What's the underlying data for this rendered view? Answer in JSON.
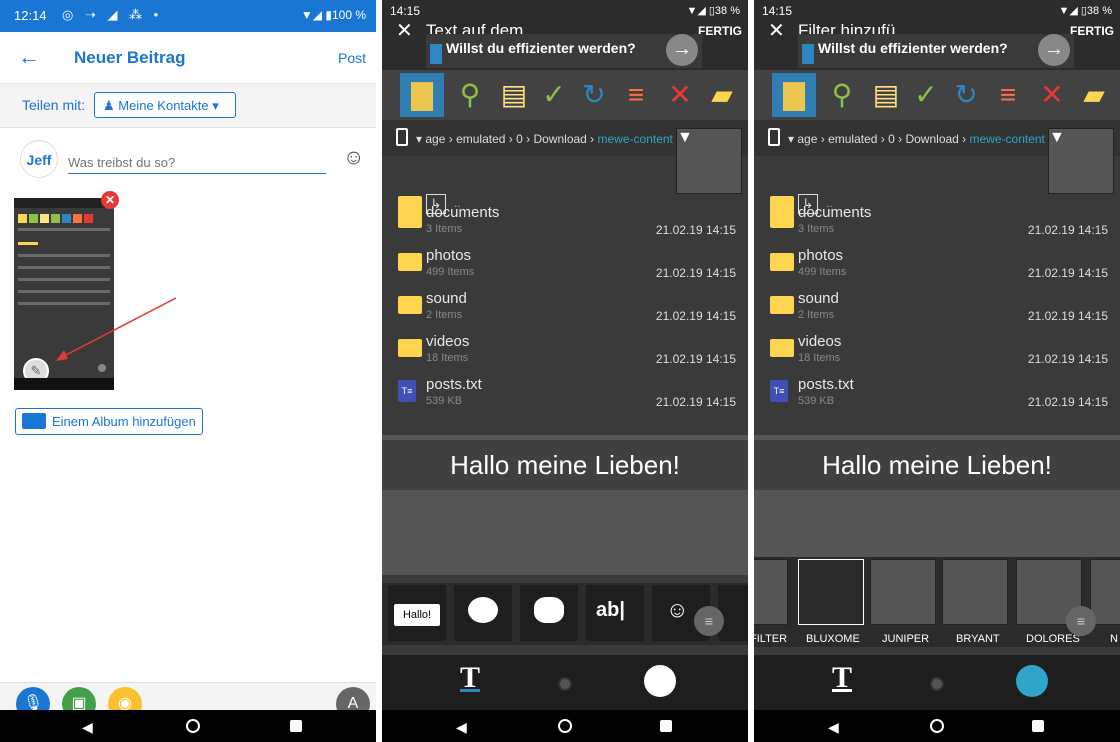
{
  "colors": {
    "blue": "#1976d2",
    "accent": "#2ea5c9",
    "folder": "#ffd54f",
    "panel": "#3a3a3a"
  },
  "p1": {
    "status": {
      "time": "12:14",
      "right": "▼◢ ▮100 %"
    },
    "header": {
      "back_icon": "arrow-left-icon",
      "title": "Neuer Beitrag",
      "post": "Post"
    },
    "share": {
      "label": "Teilen mit:",
      "button": "Meine Kontakte"
    },
    "compose": {
      "avatar": "Jeff",
      "placeholder": "Was treibst du so?"
    },
    "album": "Einem Album hinzufügen"
  },
  "p2": {
    "status": {
      "time": "14:15",
      "right": "▼◢ ▯38 %"
    },
    "title": "Text auf dem...",
    "done": "FERTIG",
    "ad": "Willst du effizienter werden?",
    "path": {
      "crumbs": [
        "age",
        "emulated",
        "0",
        "Download"
      ],
      "current": "mewe-content"
    },
    "files": [
      {
        "name": "documents",
        "sub": "3 Items",
        "date": "21.02.19 14:15",
        "kind": "folder"
      },
      {
        "name": "photos",
        "sub": "499 Items",
        "date": "21.02.19 14:15",
        "kind": "folder"
      },
      {
        "name": "sound",
        "sub": "2 Items",
        "date": "21.02.19 14:15",
        "kind": "folder"
      },
      {
        "name": "videos",
        "sub": "18 Items",
        "date": "21.02.19 14:15",
        "kind": "folder"
      },
      {
        "name": "posts.txt",
        "sub": "539 KB",
        "date": "21.02.19 14:15",
        "kind": "text"
      }
    ],
    "overlay_text": "Hallo meine Lieben!",
    "stickers": {
      "hallo": "Hallo!",
      "ab": "ab|"
    }
  },
  "p3": {
    "status": {
      "time": "14:15",
      "right": "▼◢ ▯38 %"
    },
    "title": "Filter hinzufü...",
    "done": "FERTIG",
    "ad": "Willst du effizienter werden?",
    "path": {
      "crumbs": [
        "age",
        "emulated",
        "0",
        "Download"
      ],
      "current": "mewe-content"
    },
    "files": [
      {
        "name": "documents",
        "sub": "3 Items",
        "date": "21.02.19 14:15",
        "kind": "folder"
      },
      {
        "name": "photos",
        "sub": "499 Items",
        "date": "21.02.19 14:15",
        "kind": "folder"
      },
      {
        "name": "sound",
        "sub": "2 Items",
        "date": "21.02.19 14:15",
        "kind": "folder"
      },
      {
        "name": "videos",
        "sub": "18 Items",
        "date": "21.02.19 14:15",
        "kind": "folder"
      },
      {
        "name": "posts.txt",
        "sub": "539 KB",
        "date": "21.02.19 14:15",
        "kind": "text"
      }
    ],
    "overlay_text": "Hallo meine Lieben!",
    "filters": [
      "FILTER",
      "BLUXOME",
      "JUNIPER",
      "BRYANT",
      "DOLORES",
      "N"
    ]
  }
}
